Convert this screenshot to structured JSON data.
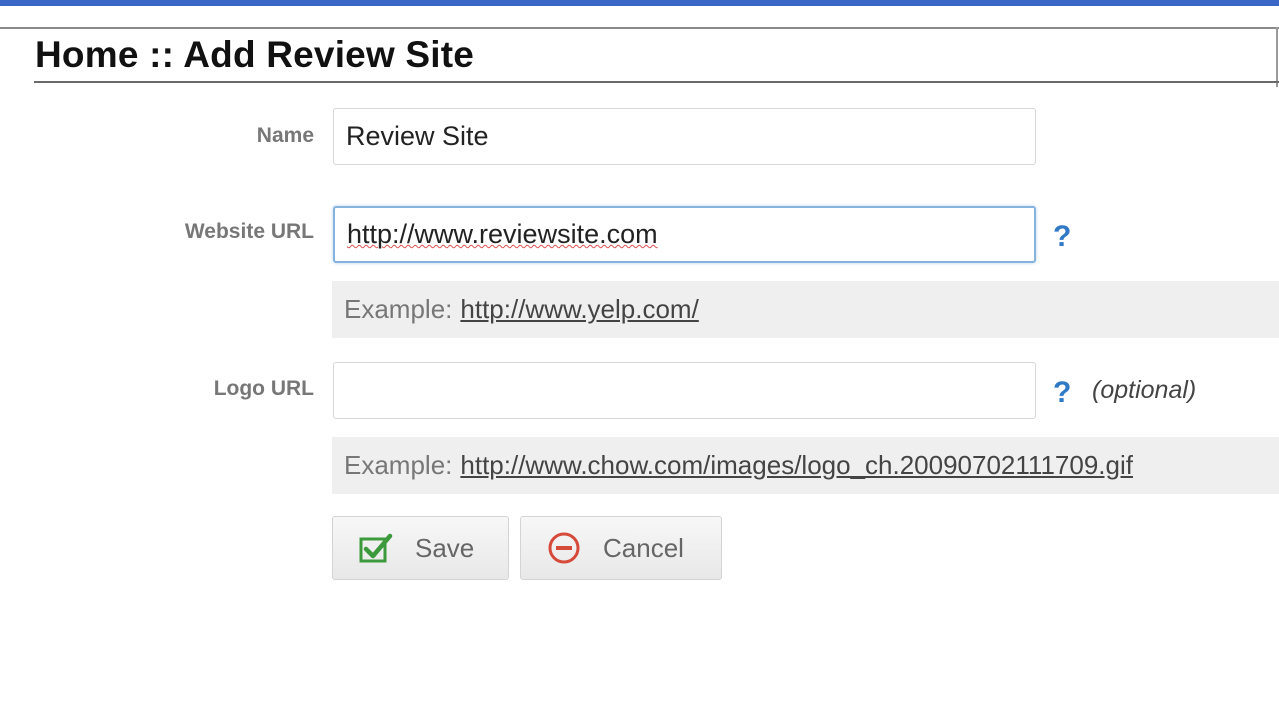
{
  "page": {
    "title": "Home :: Add Review Site"
  },
  "form": {
    "name_label": "Name",
    "name_value": "Review Site",
    "website_label": "Website URL",
    "website_value": "http://www.reviewsite.com",
    "website_help": "?",
    "website_example_prefix": "Example:",
    "website_example_link": "http://www.yelp.com/",
    "logo_label": "Logo URL",
    "logo_value": "",
    "logo_help": "?",
    "logo_optional": "(optional)",
    "logo_example_prefix": "Example:",
    "logo_example_link": "http://www.chow.com/images/logo_ch.20090702111709.gif"
  },
  "buttons": {
    "save_label": "Save",
    "cancel_label": "Cancel"
  },
  "icons": {
    "save": "check-icon",
    "cancel": "minus-circle-icon",
    "help": "question-icon"
  },
  "colors": {
    "accent_bar": "#3a66c6",
    "help": "#2f79c6",
    "save_check": "#3c9a3c",
    "cancel_circle": "#d64a3a"
  }
}
